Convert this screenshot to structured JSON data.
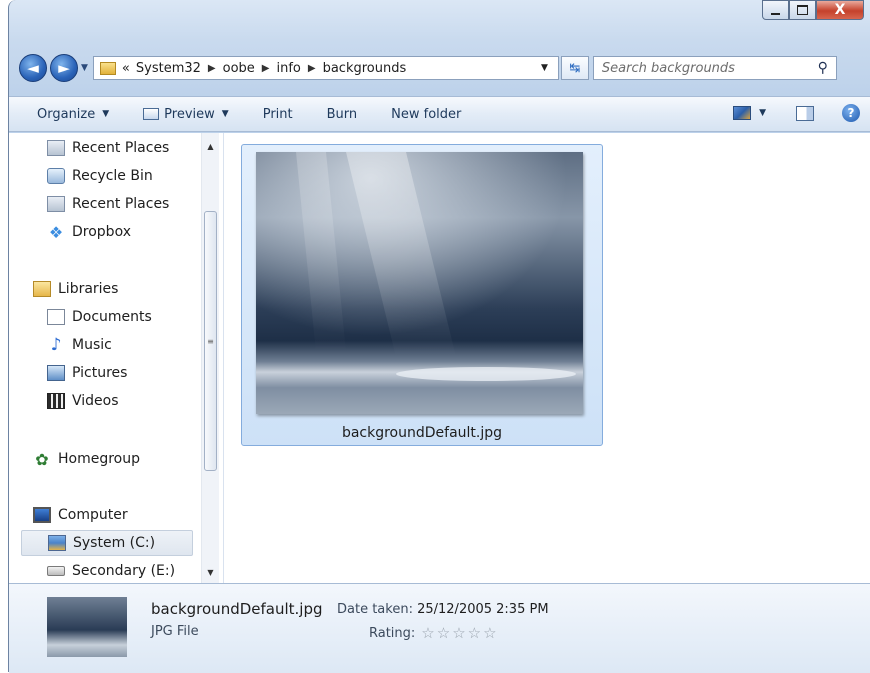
{
  "window": {
    "close_glyph": "X"
  },
  "nav": {
    "breadcrumb_prefix": "«",
    "breadcrumb": [
      "System32",
      "oobe",
      "info",
      "backgrounds"
    ],
    "search_placeholder": "Search backgrounds"
  },
  "toolbar": {
    "organize": "Organize",
    "preview": "Preview",
    "print": "Print",
    "burn": "Burn",
    "new_folder": "New folder"
  },
  "sidebar": {
    "items": [
      {
        "label": "Recent Places",
        "icon": "recent-places-icon"
      },
      {
        "label": "Recycle Bin",
        "icon": "recycle-bin-icon"
      },
      {
        "label": "Recent Places",
        "icon": "recent-places-icon"
      },
      {
        "label": "Dropbox",
        "icon": "dropbox-icon"
      },
      {
        "label": "Libraries",
        "icon": "libraries-icon"
      },
      {
        "label": "Documents",
        "icon": "documents-icon"
      },
      {
        "label": "Music",
        "icon": "music-icon"
      },
      {
        "label": "Pictures",
        "icon": "pictures-icon"
      },
      {
        "label": "Videos",
        "icon": "videos-icon"
      },
      {
        "label": "Homegroup",
        "icon": "homegroup-icon"
      },
      {
        "label": "Computer",
        "icon": "computer-icon"
      },
      {
        "label": "System (C:)",
        "icon": "drive-icon",
        "selected": true
      },
      {
        "label": "Secondary (E:)",
        "icon": "drive-icon"
      }
    ]
  },
  "content": {
    "files": [
      {
        "name": "backgroundDefault.jpg",
        "selected": true
      }
    ]
  },
  "details": {
    "filename": "backgroundDefault.jpg",
    "filetype": "JPG File",
    "date_label": "Date taken:",
    "date_value": "25/12/2005 2:35 PM",
    "rating_label": "Rating:",
    "rating_value": 0,
    "rating_max": 5,
    "stars_text": "☆☆☆☆☆"
  }
}
